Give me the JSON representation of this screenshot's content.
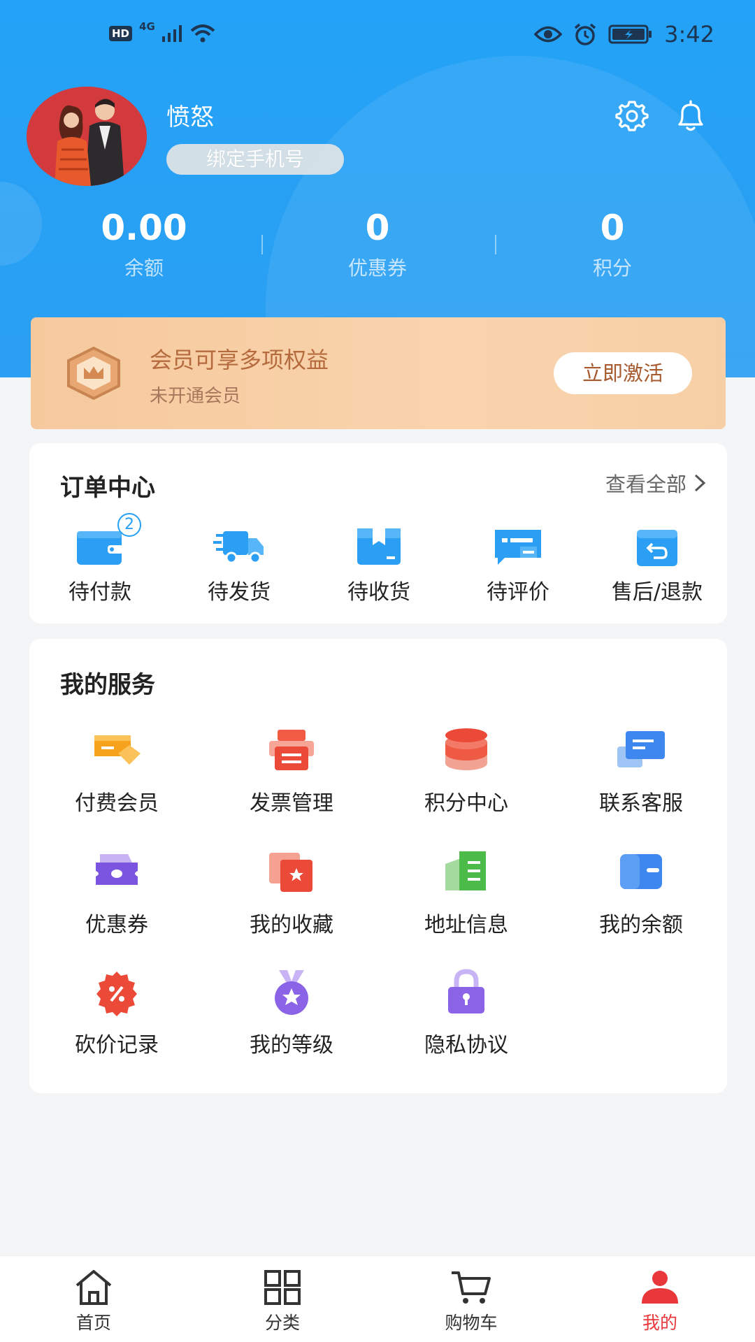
{
  "status_bar": {
    "hd": "HD",
    "network": "4G",
    "time": "3:42"
  },
  "profile": {
    "username": "愤怒",
    "bind_phone_label": "绑定手机号"
  },
  "stats": [
    {
      "value": "0.00",
      "label": "余额"
    },
    {
      "value": "0",
      "label": "优惠券"
    },
    {
      "value": "0",
      "label": "积分"
    }
  ],
  "member": {
    "title": "会员可享多项权益",
    "subtitle": "未开通会员",
    "button": "立即激活"
  },
  "orders": {
    "title": "订单中心",
    "view_all": "查看全部",
    "items": [
      {
        "label": "待付款",
        "icon": "wallet-icon",
        "badge": "2"
      },
      {
        "label": "待发货",
        "icon": "truck-icon"
      },
      {
        "label": "待收货",
        "icon": "box-icon"
      },
      {
        "label": "待评价",
        "icon": "review-icon"
      },
      {
        "label": "售后/退款",
        "icon": "refund-icon"
      }
    ]
  },
  "services": {
    "title": "我的服务",
    "items": [
      {
        "label": "付费会员",
        "icon": "vip-card-icon"
      },
      {
        "label": "发票管理",
        "icon": "invoice-icon"
      },
      {
        "label": "积分中心",
        "icon": "points-coins-icon"
      },
      {
        "label": "联系客服",
        "icon": "chat-service-icon"
      },
      {
        "label": "优惠券",
        "icon": "coupon-icon"
      },
      {
        "label": "我的收藏",
        "icon": "favorites-icon"
      },
      {
        "label": "地址信息",
        "icon": "address-book-icon"
      },
      {
        "label": "我的余额",
        "icon": "balance-wallet-icon"
      },
      {
        "label": "砍价记录",
        "icon": "discount-tag-icon"
      },
      {
        "label": "我的等级",
        "icon": "level-medal-icon"
      },
      {
        "label": "隐私协议",
        "icon": "privacy-lock-icon"
      }
    ]
  },
  "nav": [
    {
      "label": "首页",
      "icon": "home-icon"
    },
    {
      "label": "分类",
      "icon": "category-grid-icon"
    },
    {
      "label": "购物车",
      "icon": "cart-icon"
    },
    {
      "label": "我的",
      "icon": "user-icon",
      "active": true
    }
  ],
  "colors": {
    "header_blue": "#23a2f7",
    "accent_red": "#e8383c",
    "member_gold": "#f6c99d"
  }
}
